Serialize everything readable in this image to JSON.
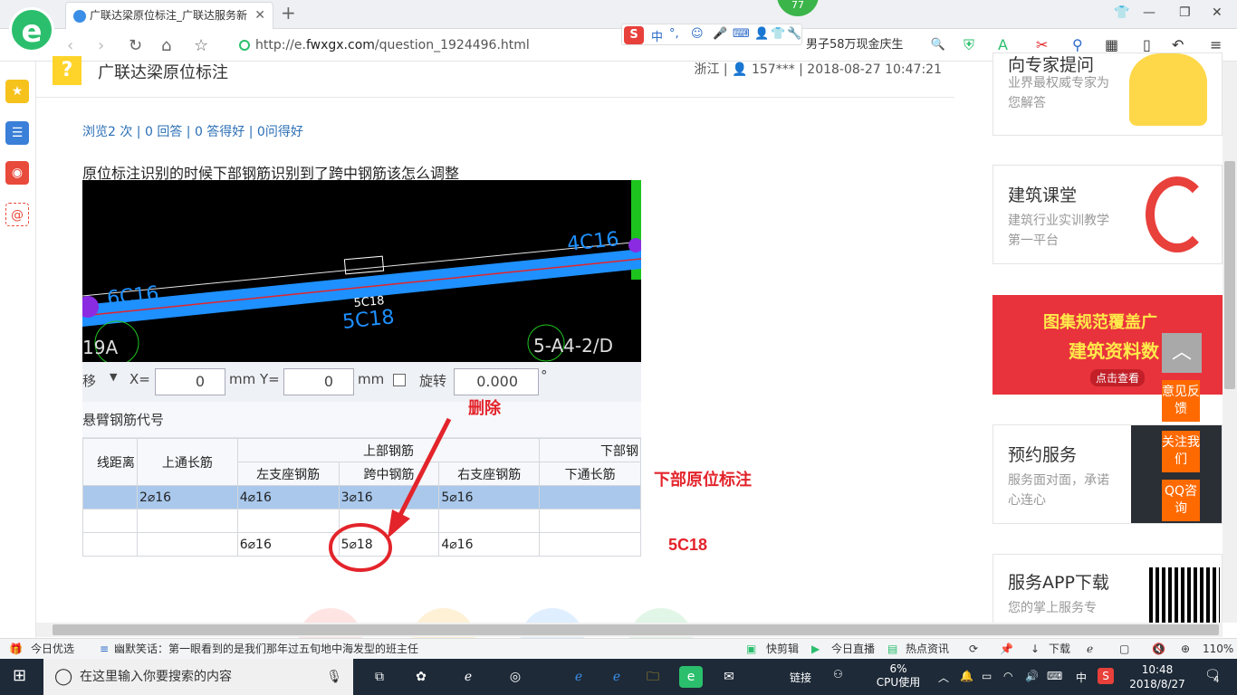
{
  "browser": {
    "tab_title": "广联达梁原位标注_广联达服务新",
    "url_prefix": "http://e.",
    "url_domain": "fwxgx.com",
    "url_path": "/question_1924496.html",
    "search_text": "男子58万现金庆生",
    "badge_count": "77",
    "zoom": "110%"
  },
  "ime": {
    "mode": "中",
    "punct": "°,",
    "icons": [
      "smile-icon",
      "mic-icon",
      "keyboard-icon",
      "user-icon",
      "shirt-icon",
      "wrench-icon"
    ]
  },
  "page": {
    "title": "广联达梁原位标注",
    "meta": "浙江 | 👤 157*** | 2018-08-27 10:47:21",
    "stats": "浏览2 次 | 0 回答 | 0 答得好 | 0问得好",
    "question": "原位标注识别的时候下部钢筋识别到了跨中钢筋该怎么调整"
  },
  "cad": {
    "label_left": "6C16",
    "label_right": "4C16",
    "label_mid_small": "5C18",
    "label_mid_big": "5C18",
    "label_bottom_left": "19A",
    "label_bottom_right": "5-A4-2/D"
  },
  "toolbar": {
    "move": "移",
    "x_label": "X=",
    "x_value": "0",
    "y_label": "Y=",
    "y_value": "0",
    "unit": "mm",
    "rotate_label": "旋转",
    "rotate_value": "0.000",
    "degree": "°"
  },
  "section": "悬臂钢筋代号",
  "grid": {
    "group_top": "上部钢筋",
    "group_bottom": "下部钢",
    "headers": [
      "线距离",
      "上通长筋",
      "左支座钢筋",
      "跨中钢筋",
      "右支座钢筋",
      "下通长筋"
    ],
    "row1": [
      "",
      "2​⌀16",
      "4⌀16",
      "3⌀16",
      "5⌀16",
      ""
    ],
    "row3": [
      "",
      "",
      "6⌀16",
      "5⌀18",
      "4⌀16",
      ""
    ]
  },
  "annotations": {
    "delete": "删除",
    "bottom_note": "下部原位标注",
    "value": "5C18"
  },
  "right": {
    "card0_title": "向专家提问",
    "card0_sub": "业界最权威专家为您解答",
    "card1_title": "建筑课堂",
    "card1_sub": "建筑行业实训教学第一平台",
    "banner_line1": "图集规范覆盖广",
    "banner_line2": "建筑资料数",
    "banner_btn": "点击查看",
    "card3_title": "预约服务",
    "card3_sub": "服务面对面，承诺心连心",
    "card4_title": "服务APP下载",
    "card4_sub": "您的掌上服务专"
  },
  "float_buttons": [
    "意见反馈",
    "关注我们",
    "QQ咨询"
  ],
  "status_bar": {
    "today": "今日优选",
    "news": "幽默笑话：第一眼看到的是我们那年过五旬地中海发型的班主任",
    "items": [
      "快剪辑",
      "今日直播",
      "热点资讯",
      "下载"
    ]
  },
  "taskbar": {
    "search_placeholder": "在这里输入你要搜索的内容",
    "link": "链接",
    "cpu_percent": "6%",
    "cpu_label": "CPU使用",
    "ime": "中",
    "time": "10:48",
    "date": "2018/8/27",
    "notif": "4"
  },
  "colors": {
    "brand_green": "#2bbf6d",
    "beam_blue": "#1e90ff",
    "annotation_red": "#e3242b",
    "float_orange": "#ff6a00"
  }
}
